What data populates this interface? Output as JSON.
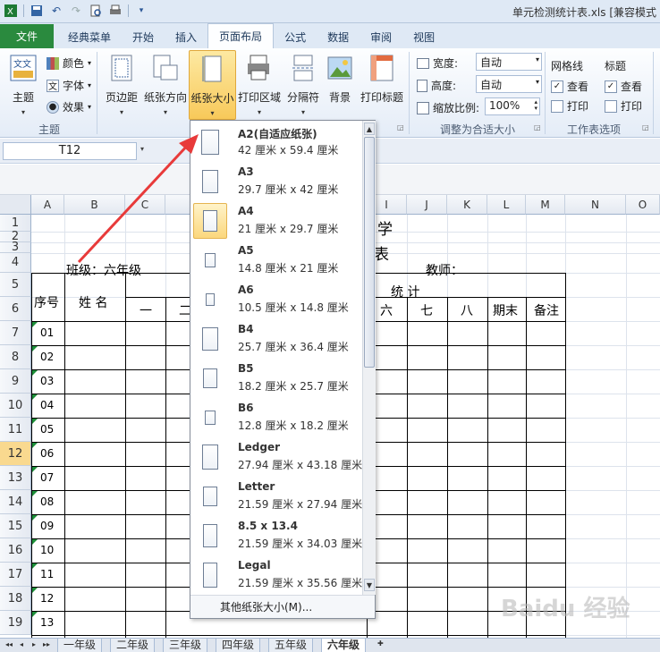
{
  "window": {
    "title": "单元检测统计表.xls  [兼容模式"
  },
  "tabs": [
    {
      "label": "文件",
      "kind": "file"
    },
    {
      "label": "经典菜单"
    },
    {
      "label": "开始"
    },
    {
      "label": "插入"
    },
    {
      "label": "页面布局",
      "active": true
    },
    {
      "label": "公式"
    },
    {
      "label": "数据"
    },
    {
      "label": "审阅"
    },
    {
      "label": "视图"
    }
  ],
  "ribbon": {
    "theme_group": {
      "label": "主题",
      "theme_btn": "主题",
      "colors": "颜色",
      "fonts": "字体",
      "effects": "效果"
    },
    "page_setup": {
      "margins": "页边距",
      "orientation": "纸张方向",
      "size": "纸张大小",
      "print_area": "打印区域",
      "breaks": "分隔符",
      "background": "背景",
      "print_titles": "打印标题"
    },
    "scale_group": {
      "label": "调整为合适大小",
      "width_label": "宽度:",
      "width_value": "自动",
      "height_label": "高度:",
      "height_value": "自动",
      "scale_label": "缩放比例:",
      "scale_value": "100%"
    },
    "sheet_options": {
      "label": "工作表选项",
      "gridlines": "网格线",
      "headings": "标题",
      "view": "查看",
      "print": "打印"
    }
  },
  "formula_bar": {
    "name_box": "T12"
  },
  "columns": [
    "A",
    "B",
    "C",
    "D",
    "I",
    "J",
    "K",
    "L",
    "M",
    "N",
    "O"
  ],
  "rows": [
    "1",
    "2",
    "3",
    "4",
    "5",
    "6",
    "7",
    "8",
    "9",
    "10",
    "11",
    "12",
    "13",
    "14",
    "15",
    "16",
    "17",
    "18",
    "19"
  ],
  "sheet": {
    "title_fragment": "学",
    "title_fragment2": "表",
    "class_label": "班级：六年级",
    "teacher_label": "教师：",
    "col_seq": "序号",
    "col_name": "姓 名",
    "stats_label": "统    计",
    "units": [
      "一",
      "二",
      "六",
      "七",
      "八",
      "期末",
      "备注"
    ],
    "seq_numbers": [
      "01",
      "02",
      "03",
      "04",
      "05",
      "06",
      "07",
      "08",
      "09",
      "10",
      "11",
      "12",
      "13"
    ]
  },
  "dropdown": {
    "items": [
      {
        "name": "A2(自适应纸张)",
        "size": "42 厘米 x 59.4 厘米"
      },
      {
        "name": "A3",
        "size": "29.7 厘米 x 42 厘米"
      },
      {
        "name": "A4",
        "size": "21 厘米 x 29.7 厘米",
        "selected": true
      },
      {
        "name": "A5",
        "size": "14.8 厘米 x 21 厘米"
      },
      {
        "name": "A6",
        "size": "10.5 厘米 x 14.8 厘米"
      },
      {
        "name": "B4",
        "size": "25.7 厘米 x 36.4 厘米"
      },
      {
        "name": "B5",
        "size": "18.2 厘米 x 25.7 厘米"
      },
      {
        "name": "B6",
        "size": "12.8 厘米 x 18.2 厘米"
      },
      {
        "name": "Ledger",
        "size": "27.94 厘米 x 43.18 厘米"
      },
      {
        "name": "Letter",
        "size": "21.59 厘米 x 27.94 厘米"
      },
      {
        "name": "8.5 x 13.4",
        "size": "21.59 厘米 x 34.03 厘米"
      },
      {
        "name": "Legal",
        "size": "21.59 厘米 x 35.56 厘米"
      }
    ],
    "more": "其他纸张大小(M)..."
  },
  "sheet_tabs": [
    "一年级",
    "二年级",
    "三年级",
    "四年级",
    "五年级",
    "六年级"
  ],
  "active_sheet": "六年级",
  "watermark": "Baidu 经验",
  "colors": {
    "file_tab": "#2a8a3e",
    "selected_highlight": "#f8c95a",
    "arrow": "#e83a3a"
  }
}
